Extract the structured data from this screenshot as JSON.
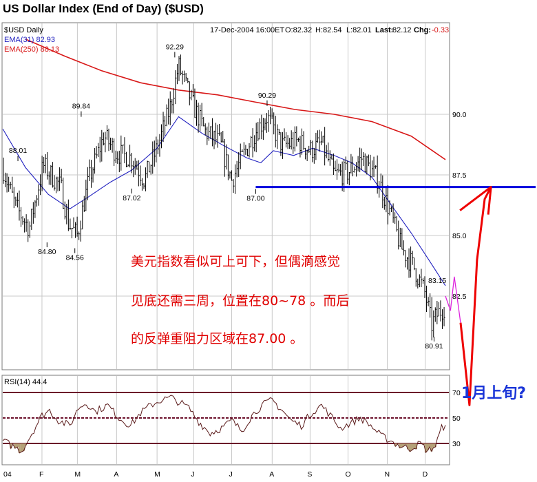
{
  "header": {
    "title": "US Dollar Index (End of Day) ($USD)",
    "symbol": "$USD Daily",
    "date": "17-Dec-2004 16:00ET",
    "open": "O:82.32",
    "high": "H:82.54",
    "low": "L:82.01",
    "last_label": "Last:",
    "last": "82.12",
    "chg_label": "Chg:",
    "chg": "-0.33",
    "ema31": "EMA(31) 82.93",
    "ema250": "EMA(250) 88.13"
  },
  "annotation": {
    "line1": "美元指数看似可上可下，但偶滴感觉",
    "line2": "见底还需三周，位置在80~78 。而后",
    "line3": "的反弹重阻力区域在87.00 。",
    "forecast_label": "1月上旬?",
    "ema_value_label": "83.15"
  },
  "rsi_panel": {
    "label": "RSI(14) 44.4"
  },
  "colors": {
    "price": "#000000",
    "ema31": "#1f1fbf",
    "ema250": "#d81818",
    "grid": "#c8c8c8",
    "resistance": "#0000dd",
    "forecast_red": "#ee0000",
    "forecast_magenta": "#dd22dd",
    "rsi_band": "#6b0f2a",
    "rsi_fill": "#b5a178",
    "annotation": "#e00000",
    "forecast_label": "#1a35d8"
  },
  "chart_data": [
    {
      "type": "line",
      "title": "US Dollar Index (End of Day) ($USD)",
      "x_tick_labels": [
        "04",
        "F",
        "M",
        "A",
        "M",
        "J",
        "J",
        "A",
        "S",
        "O",
        "N",
        "D"
      ],
      "y_tick_labels": [
        "82.5",
        "85.0",
        "87.5",
        "90.0"
      ],
      "ylim": [
        80.2,
        93.2
      ],
      "price_path": {
        "dates": [
          "2004-01-02",
          "2004-01-12",
          "2004-01-23",
          "2004-02-03",
          "2004-02-17",
          "2004-02-23",
          "2004-03-01",
          "2004-03-10",
          "2004-03-22",
          "2004-04-01",
          "2004-04-13",
          "2004-04-23",
          "2004-05-03",
          "2004-05-13",
          "2004-05-20",
          "2004-06-01",
          "2004-06-10",
          "2004-06-22",
          "2004-07-01",
          "2004-07-12",
          "2004-07-20",
          "2004-07-29",
          "2004-08-10",
          "2004-08-23",
          "2004-09-01",
          "2004-09-10",
          "2004-09-20",
          "2004-10-01",
          "2004-10-12",
          "2004-10-25",
          "2004-11-03",
          "2004-11-12",
          "2004-11-22",
          "2004-12-01",
          "2004-12-06",
          "2004-12-10",
          "2004-12-17"
        ],
        "close": [
          87.8,
          86.2,
          85.3,
          87.9,
          87.0,
          85.5,
          85.0,
          87.3,
          89.1,
          88.4,
          88.2,
          87.3,
          88.6,
          90.2,
          92.0,
          90.3,
          89.3,
          88.8,
          87.3,
          88.5,
          89.3,
          89.9,
          88.7,
          88.9,
          88.5,
          88.8,
          87.5,
          87.6,
          88.2,
          87.3,
          86.0,
          84.5,
          83.7,
          82.6,
          81.3,
          81.7,
          82.12
        ]
      },
      "annotated_prices": [
        {
          "date": "2004-01-14",
          "label": "88.01"
        },
        {
          "date": "2004-02-06",
          "label": "84.80"
        },
        {
          "date": "2004-02-28",
          "label": "84.56"
        },
        {
          "date": "2004-03-04",
          "label": "89.84"
        },
        {
          "date": "2004-04-13",
          "label": "87.02"
        },
        {
          "date": "2004-05-17",
          "label": "92.29"
        },
        {
          "date": "2004-07-20",
          "label": "87.00"
        },
        {
          "date": "2004-07-29",
          "label": "90.29"
        },
        {
          "date": "2004-12-08",
          "label": "80.91"
        }
      ],
      "series": [
        {
          "name": "EMA(31) 82.93",
          "dates": [
            "2004-01-02",
            "2004-01-20",
            "2004-02-07",
            "2004-02-24",
            "2004-03-10",
            "2004-03-27",
            "2004-04-13",
            "2004-05-03",
            "2004-05-20",
            "2004-06-08",
            "2004-06-25",
            "2004-07-13",
            "2004-07-24",
            "2004-08-03",
            "2004-08-19",
            "2004-09-03",
            "2004-09-20",
            "2004-10-04",
            "2004-10-20",
            "2004-11-05",
            "2004-11-20",
            "2004-12-05",
            "2004-12-17"
          ],
          "values": [
            89.4,
            87.8,
            86.7,
            86.1,
            86.6,
            87.2,
            87.7,
            88.6,
            89.9,
            89.2,
            88.7,
            88.2,
            88.0,
            88.5,
            88.3,
            88.6,
            88.3,
            88.0,
            87.4,
            86.2,
            85.1,
            83.9,
            82.93
          ]
        },
        {
          "name": "EMA(250) 88.13",
          "dates": [
            "2004-01-20",
            "2004-02-20",
            "2004-03-20",
            "2004-04-20",
            "2004-05-20",
            "2004-06-20",
            "2004-07-20",
            "2004-08-20",
            "2004-09-20",
            "2004-10-20",
            "2004-11-20",
            "2004-12-17"
          ],
          "values": [
            93.1,
            92.4,
            91.8,
            91.3,
            91.0,
            90.8,
            90.5,
            90.2,
            90.0,
            89.7,
            89.1,
            88.13
          ]
        }
      ],
      "resistance_level": 87.0,
      "ema31_label_value": 83.15,
      "forecast_path": {
        "dates": [
          "2004-12-17",
          "2004-12-21",
          "2004-12-24",
          "2004-12-29",
          "2005-01-05",
          "2005-01-11",
          "2005-01-17",
          "2005-01-22"
        ],
        "values": [
          82.5,
          81.9,
          83.3,
          81.4,
          78.0,
          84.0,
          86.5,
          87.0
        ]
      }
    },
    {
      "type": "line",
      "title": "RSI(14) 44.4",
      "y_tick_labels": [
        "30",
        "50",
        "70"
      ],
      "ylim": [
        14,
        80
      ],
      "reference_lines": [
        30,
        50,
        70
      ],
      "series": [
        {
          "name": "RSI(14) 44.4",
          "dates": [
            "2004-01-02",
            "2004-01-10",
            "2004-01-17",
            "2004-01-25",
            "2004-02-02",
            "2004-02-08",
            "2004-02-15",
            "2004-02-24",
            "2004-03-02",
            "2004-03-08",
            "2004-03-15",
            "2004-03-25",
            "2004-04-03",
            "2004-04-12",
            "2004-04-20",
            "2004-04-28",
            "2004-05-06",
            "2004-05-14",
            "2004-05-21",
            "2004-05-28",
            "2004-06-05",
            "2004-06-14",
            "2004-06-23",
            "2004-07-01",
            "2004-07-09",
            "2004-07-17",
            "2004-07-25",
            "2004-08-02",
            "2004-08-10",
            "2004-08-17",
            "2004-08-25",
            "2004-09-02",
            "2004-09-10",
            "2004-09-17",
            "2004-09-25",
            "2004-10-03",
            "2004-10-11",
            "2004-10-19",
            "2004-10-27",
            "2004-11-04",
            "2004-11-11",
            "2004-11-19",
            "2004-11-27",
            "2004-12-03",
            "2004-12-09",
            "2004-12-14",
            "2004-12-17"
          ],
          "values": [
            32,
            28,
            24,
            38,
            52,
            56,
            48,
            44,
            58,
            62,
            55,
            60,
            50,
            44,
            54,
            60,
            64,
            66,
            62,
            58,
            47,
            38,
            42,
            48,
            40,
            52,
            60,
            64,
            56,
            48,
            44,
            54,
            60,
            52,
            42,
            46,
            50,
            44,
            36,
            32,
            28,
            26,
            30,
            24,
            28,
            42,
            44.4
          ]
        }
      ]
    }
  ]
}
